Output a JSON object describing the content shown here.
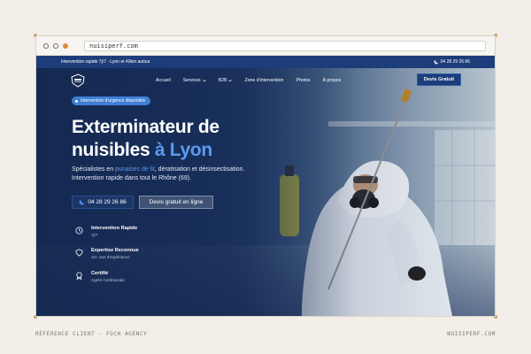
{
  "browser": {
    "url": "nuisiperf.com"
  },
  "topbar": {
    "left_text": "Intervention rapide 7j/7 · Lyon et 40km autour",
    "phone": "04 28 29 26 86"
  },
  "nav": {
    "items": [
      {
        "label": "Accueil"
      },
      {
        "label": "Services"
      },
      {
        "label": "B2B"
      },
      {
        "label": "Zone d'intervention"
      },
      {
        "label": "Photos"
      },
      {
        "label": "À propos"
      }
    ],
    "cta_label": "Devis Gratuit"
  },
  "hero": {
    "badge": "Intervention d'urgence disponible",
    "title_line1": "Exterminateur de",
    "title_line2_a": "nuisibles ",
    "title_line2_b": "à Lyon",
    "desc_a": "Spécialistes en ",
    "desc_accent": "punaises de lit",
    "desc_b": ", dératisation et désinsectisation. Intervention rapide dans tout le Rhône (69).",
    "phone_button": "04 28 29 26 86",
    "quote_button": "Devis gratuit en ligne",
    "features": [
      {
        "title": "Intervention Rapide",
        "sub": "7j/7",
        "icon": "clock-icon"
      },
      {
        "title": "Expertise Reconnue",
        "sub": "10+ ans d'expérience",
        "icon": "shield-icon"
      },
      {
        "title": "Certifié",
        "sub": "Agréé Certibiocide",
        "icon": "badge-icon"
      }
    ]
  },
  "caption": {
    "left": "RÉFÉRENCE CLIENT - FOCH AGENCY",
    "right": "NUISIPERF.COM"
  },
  "colors": {
    "accent": "#5b9cf0",
    "navy": "#1d3d7a",
    "badge": "#3f7fd6",
    "background": "#f3efe8"
  }
}
